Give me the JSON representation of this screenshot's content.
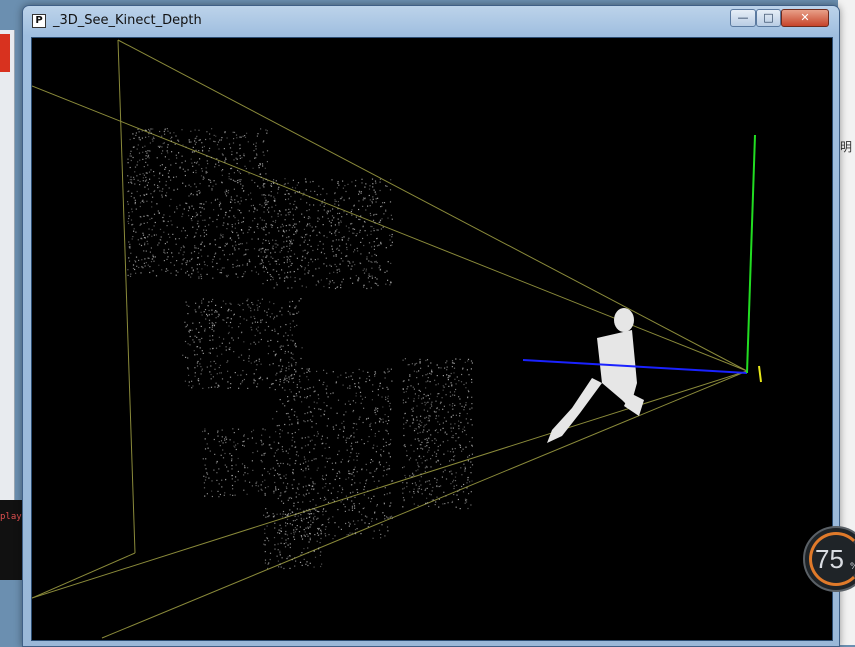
{
  "window": {
    "title": "_3D_See_Kinect_Depth",
    "icon_glyph": "P",
    "minimize_icon": "minimize-icon",
    "maximize_icon": "maximize-icon",
    "close_icon": "close-icon"
  },
  "viewport": {
    "background_color": "#000000",
    "frustum_color": "#8a8a3a",
    "axis_x_color": "#1a22ff",
    "axis_y_color": "#22dd22",
    "axis_z_color": "#e8e81a",
    "point_cloud_color": "#cfcfcf"
  },
  "background": {
    "console_text": "play",
    "right_edge_char": "明"
  },
  "gauge": {
    "value": "75",
    "unit": "%",
    "fill_percent": 75,
    "accent_color": "#e07a2a"
  }
}
